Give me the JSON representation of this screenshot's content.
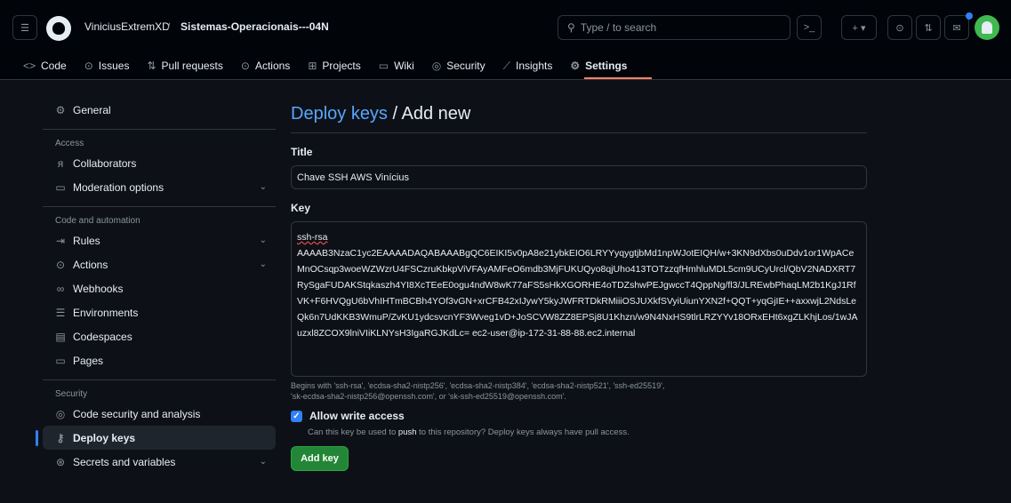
{
  "header": {
    "owner": "ViniciusExtremXD",
    "separator": "/",
    "repo": "Sistemas-Operacionais---04N",
    "search_placeholder": "Type / to search"
  },
  "tabs": [
    {
      "label": "Code",
      "icon": "code-icon"
    },
    {
      "label": "Issues",
      "icon": "issue-icon"
    },
    {
      "label": "Pull requests",
      "icon": "pull-request-icon"
    },
    {
      "label": "Actions",
      "icon": "play-icon"
    },
    {
      "label": "Projects",
      "icon": "table-icon"
    },
    {
      "label": "Wiki",
      "icon": "book-icon"
    },
    {
      "label": "Security",
      "icon": "shield-icon"
    },
    {
      "label": "Insights",
      "icon": "graph-icon"
    },
    {
      "label": "Settings",
      "icon": "gear-icon",
      "active": true
    }
  ],
  "sidebar": {
    "general": "General",
    "access_heading": "Access",
    "collaborators": "Collaborators",
    "moderation": "Moderation options",
    "code_heading": "Code and automation",
    "rules": "Rules",
    "actions": "Actions",
    "webhooks": "Webhooks",
    "environments": "Environments",
    "codespaces": "Codespaces",
    "pages": "Pages",
    "security_heading": "Security",
    "code_security": "Code security and analysis",
    "deploy_keys": "Deploy keys",
    "secrets": "Secrets and variables"
  },
  "main": {
    "breadcrumb_link": "Deploy keys",
    "breadcrumb_rest": " / Add new",
    "title_label": "Title",
    "title_value": "Chave SSH AWS Vinícius",
    "key_label": "Key",
    "key_prefix": "ssh-rsa",
    "key_body": "AAAAB3NzaC1yc2EAAAADAQABAAABgQC6EIKI5v0pA8e21ybkEIO6LRYYyqygtjbMd1npWJotEIQH/w+3KN9dXbs0uDdv1or1WpACeMnOCsqp3woeWZWzrU4FSCzruKbkpViVFAyAMFeO6mdb3MjFUKUQyo8qjUho413TOTzzqfHmhluMDL5cm9UCyUrcl/QbV2NADXRT7RySgaFUDAKStqkaszh4YI8XcTEeE0ogu4ndW8wK77aFS5sHkXGORHE4oTDZshwPEJgwccT4QppNg/fl3/JLREwbPhaqLM2b1KgJ1RfVK+F6HVQgU6bVhIHTmBCBh4YOf3vGN+xrCFB42xIJywY5kyJWFRTDkRMiiiOSJUXkfSVyiUiunYXN2f+QQT+yqGjIE++axxwjL2NdsLeQk6n7UdKKB3WmuP/ZvKU1ydcsvcnYF3Wveg1vD+JoSCVW8ZZ8EPSj8U1Khzn/w9N4NxHS9tlrLRZYYv18ORxEHt6xgZLKhjLos/1wJAuzxl8ZCOX9lniVIiKLNYsH3IgaRGJKdLc= ec2-user@ip-172-31-88-88.ec2.internal",
    "key_hint_1": "Begins with 'ssh-rsa', 'ecdsa-sha2-nistp256', 'ecdsa-sha2-nistp384', 'ecdsa-sha2-nistp521', 'ssh-ed25519',",
    "key_hint_2": "'sk-ecdsa-sha2-nistp256@openssh.com', or 'sk-ssh-ed25519@openssh.com'.",
    "allow_write_label": "Allow write access",
    "allow_write_checked": true,
    "allow_write_help_pre": "Can this key be used to ",
    "allow_write_help_bold": "push",
    "allow_write_help_post": " to this repository? Deploy keys always have pull access.",
    "add_key_button": "Add key"
  },
  "colors": {
    "accent": "#2f81f7",
    "link": "#58a6ff",
    "button_green": "#238636",
    "tab_underline": "#f78166",
    "background": "#0d1117"
  }
}
